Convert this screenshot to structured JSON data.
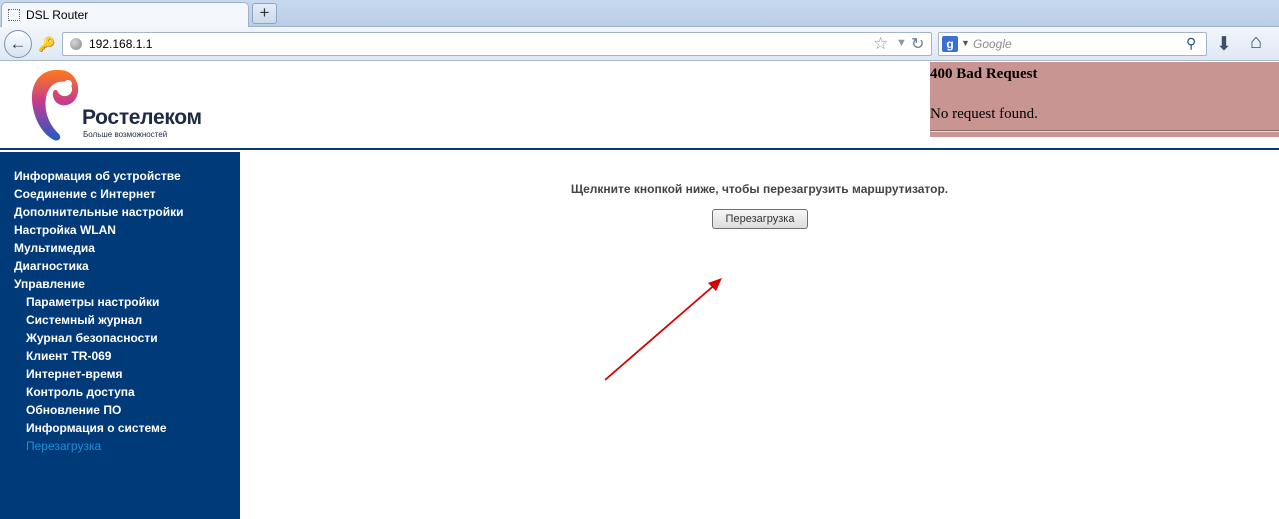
{
  "browser": {
    "tab_title": "DSL Router",
    "new_tab_symbol": "+",
    "url": "192.168.1.1",
    "search_placeholder": "Google",
    "search_engine_letter": "g"
  },
  "header": {
    "brand_name": "Ростелеком",
    "brand_slogan": "Больше возможностей"
  },
  "error_frame": {
    "title": "400 Bad Request",
    "message": "No request found."
  },
  "sidebar": {
    "items": [
      {
        "label": "Информация об устройстве"
      },
      {
        "label": "Соединение с Интернет"
      },
      {
        "label": "Дополнительные настройки"
      },
      {
        "label": "Настройка WLAN"
      },
      {
        "label": "Мультимедиа"
      },
      {
        "label": "Диагностика"
      },
      {
        "label": "Управление"
      },
      {
        "label": "Параметры настройки"
      },
      {
        "label": "Системный журнал"
      },
      {
        "label": "Журнал безопасности"
      },
      {
        "label": "Клиент TR-069"
      },
      {
        "label": "Интернет-время"
      },
      {
        "label": "Контроль доступа"
      },
      {
        "label": "Обновление ПО"
      },
      {
        "label": "Информация о системе"
      },
      {
        "label": "Перезагрузка"
      }
    ]
  },
  "main": {
    "instruction": "Щелкните кнопкой ниже, чтобы перезагрузить маршрутизатор.",
    "reboot_button_label": "Перезагрузка"
  },
  "colors": {
    "sidebar_bg": "#003a78",
    "active_menu_item": "#1e8fd9",
    "error_frame_bg": "#c99593",
    "annotation_arrow": "#d40000"
  }
}
